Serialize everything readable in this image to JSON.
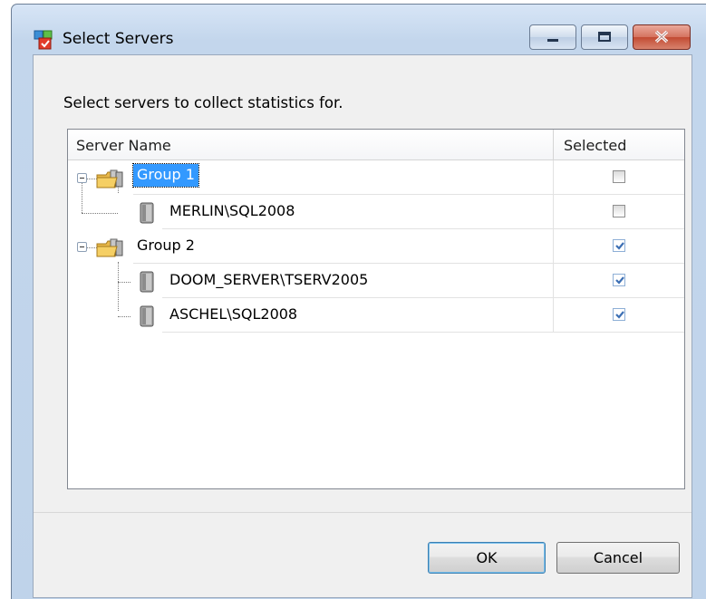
{
  "window": {
    "title": "Select Servers",
    "controls": {
      "minimize": "minimize",
      "maximize": "maximize",
      "close": "close"
    }
  },
  "instruction": "Select servers to collect statistics for.",
  "grid": {
    "columns": [
      "Server Name",
      "Selected"
    ],
    "rows": [
      {
        "type": "group",
        "label": "Group 1",
        "checked": false,
        "selected": true
      },
      {
        "type": "server",
        "label": "MERLIN\\SQL2008",
        "checked": false
      },
      {
        "type": "group",
        "label": "Group 2",
        "checked": true
      },
      {
        "type": "server",
        "label": "DOOM_SERVER\\TSERV2005",
        "checked": true
      },
      {
        "type": "server",
        "label": "ASCHEL\\SQL2008",
        "checked": true
      }
    ]
  },
  "buttons": {
    "ok": "OK",
    "cancel": "Cancel"
  },
  "colors": {
    "selection": "#3399ff",
    "check_mark": "#3c6fb4"
  }
}
